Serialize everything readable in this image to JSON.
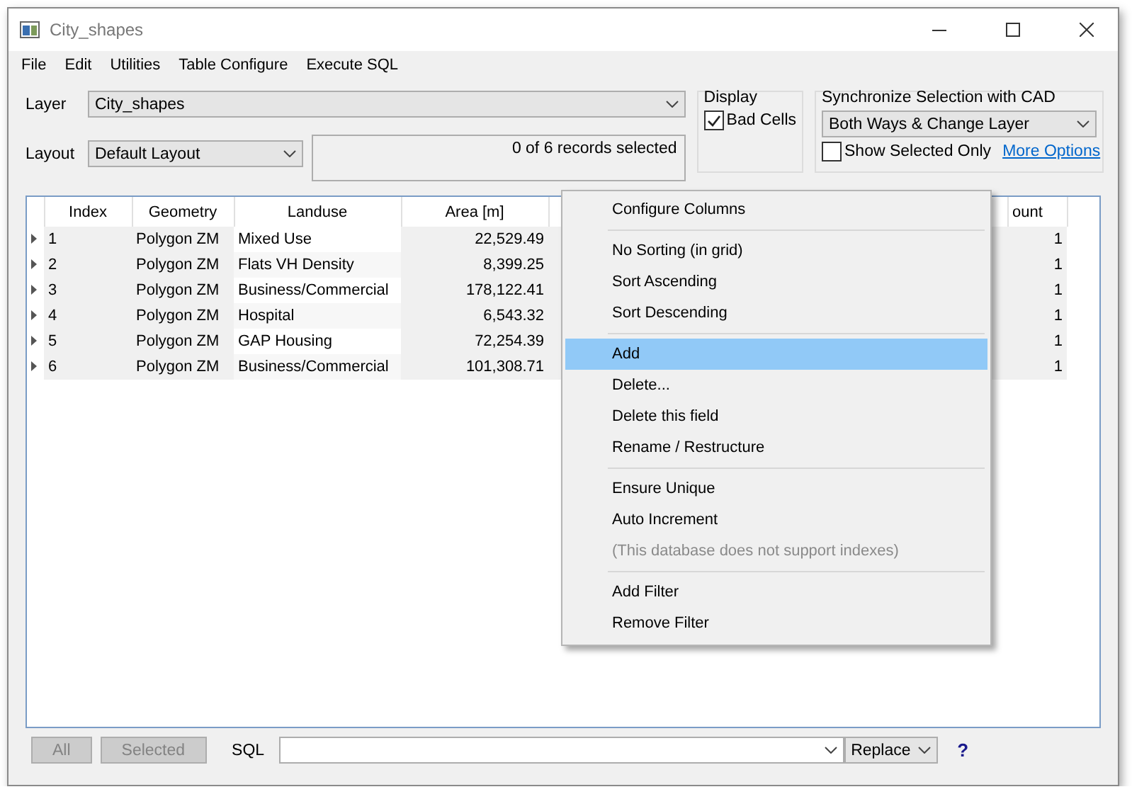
{
  "window": {
    "title": "City_shapes"
  },
  "menu_bar": [
    "File",
    "Edit",
    "Utilities",
    "Table Configure",
    "Execute SQL"
  ],
  "layer": {
    "label": "Layer",
    "value": "City_shapes"
  },
  "layout": {
    "label": "Layout",
    "value": "Default Layout"
  },
  "records_status": "0 of 6 records selected",
  "display": {
    "title": "Display",
    "bad_cells": {
      "label": "Bad Cells",
      "checked": true
    }
  },
  "sync": {
    "title": "Synchronize Selection with CAD",
    "value": "Both Ways & Change Layer",
    "show_selected_only": {
      "label": "Show Selected Only",
      "checked": false
    },
    "link": "More Options"
  },
  "table": {
    "columns": [
      "Index",
      "Geometry",
      "Landuse",
      "Area [m]",
      "",
      "ount"
    ],
    "rows": [
      {
        "cells": [
          "1",
          "Polygon ZM",
          "Mixed Use",
          "22,529.49",
          "",
          "1"
        ]
      },
      {
        "cells": [
          "2",
          "Polygon ZM",
          "Flats VH Density",
          "8,399.25",
          "",
          "1"
        ]
      },
      {
        "cells": [
          "3",
          "Polygon ZM",
          "Business/Commercial",
          "178,122.41",
          "",
          "1"
        ]
      },
      {
        "cells": [
          "4",
          "Polygon ZM",
          "Hospital",
          "6,543.32",
          "",
          "1"
        ]
      },
      {
        "cells": [
          "5",
          "Polygon ZM",
          "GAP Housing",
          "72,254.39",
          "",
          "1"
        ]
      },
      {
        "cells": [
          "6",
          "Polygon ZM",
          "Business/Commercial",
          "101,308.71",
          "",
          "1"
        ]
      }
    ]
  },
  "context_menu": {
    "groups": [
      [
        {
          "label": "Configure Columns",
          "selected": false,
          "disabled": false
        }
      ],
      [
        {
          "label": "No Sorting (in grid)",
          "selected": false,
          "disabled": false
        },
        {
          "label": "Sort Ascending",
          "selected": false,
          "disabled": false
        },
        {
          "label": "Sort Descending",
          "selected": false,
          "disabled": false
        }
      ],
      [
        {
          "label": "Add",
          "selected": true,
          "disabled": false
        },
        {
          "label": "Delete...",
          "selected": false,
          "disabled": false
        },
        {
          "label": "Delete this field",
          "selected": false,
          "disabled": false
        },
        {
          "label": "Rename / Restructure",
          "selected": false,
          "disabled": false
        }
      ],
      [
        {
          "label": "Ensure Unique",
          "selected": false,
          "disabled": false
        },
        {
          "label": "Auto Increment",
          "selected": false,
          "disabled": false
        },
        {
          "label": "(This database does not support indexes)",
          "selected": false,
          "disabled": true
        }
      ],
      [
        {
          "label": "Add Filter",
          "selected": false,
          "disabled": false
        },
        {
          "label": "Remove Filter",
          "selected": false,
          "disabled": false
        }
      ]
    ]
  },
  "bottom_bar": {
    "buttons": [
      {
        "label": "All",
        "disabled": true
      },
      {
        "label": "Selected",
        "disabled": true
      }
    ],
    "sql_label": "SQL",
    "mode": "Replace",
    "help": "?"
  }
}
